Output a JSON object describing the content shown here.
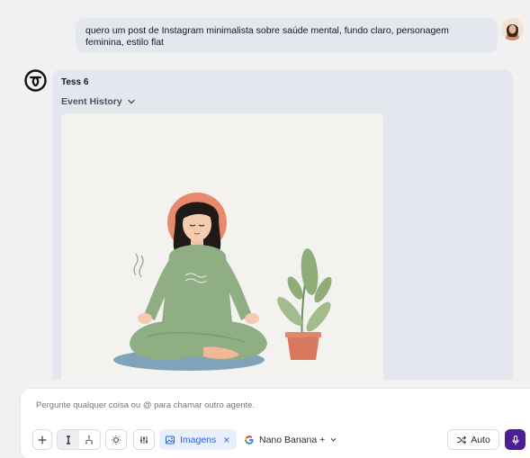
{
  "user_message": {
    "text": "quero um post de Instagram minimalista sobre saúde mental, fundo claro, personagem feminina, estilo flat"
  },
  "agent": {
    "name": "Tess 6",
    "event_history_label": "Event History"
  },
  "composer": {
    "placeholder": "Pergunte qualquer coisa ou @ para chamar outro agente.",
    "imagens_label": "Imagens",
    "imagens_remove": "×",
    "model_label": "Nano Banana +",
    "auto_label": "Auto"
  },
  "icons": {
    "add": "plus-icon",
    "text_mode": "text-cursor-icon",
    "workflow_mode": "hierarchy-icon",
    "ideas": "lightbulb-icon",
    "settings": "sliders-icon",
    "image": "image-icon",
    "google": "google-icon",
    "shuffle": "shuffle-icon",
    "mic": "microphone-icon",
    "download": "arrow-down-icon",
    "chevron": "chevron-down-icon"
  },
  "colors": {
    "accent": "#2563eb",
    "mic_bg": "#4c1d95",
    "card_bg": "#e4e7ee"
  }
}
